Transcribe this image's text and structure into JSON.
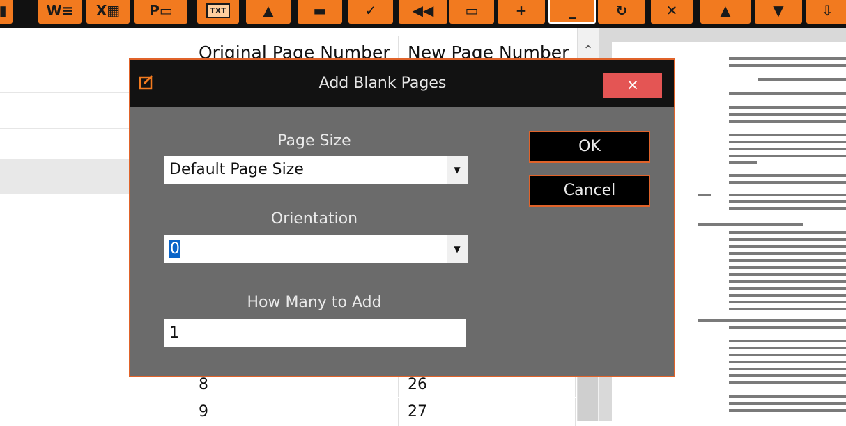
{
  "toolbar": {
    "buttons": [
      {
        "icon": "page-icon"
      },
      {
        "icon": "word-export-icon"
      },
      {
        "icon": "excel-export-icon"
      },
      {
        "icon": "powerpoint-export-icon"
      },
      {
        "icon": "txt-export-icon",
        "label": "TXT"
      },
      {
        "icon": "image-export-icon"
      },
      {
        "icon": "printer-icon"
      },
      {
        "icon": "check-icon"
      },
      {
        "icon": "rewind-icon"
      },
      {
        "icon": "screen-icon"
      },
      {
        "icon": "add-page-icon"
      },
      {
        "icon": "blank-page-icon",
        "selected": true
      },
      {
        "icon": "rotate-icon"
      },
      {
        "icon": "delete-page-icon"
      },
      {
        "icon": "move-up-icon"
      },
      {
        "icon": "move-down-icon"
      },
      {
        "icon": "move-bottom-icon"
      }
    ]
  },
  "grid": {
    "columns": [
      "Original Page Number",
      "New Page Number"
    ],
    "rows": [
      {
        "original": "8",
        "new": "26"
      },
      {
        "original": "9",
        "new": "27"
      }
    ]
  },
  "dialog": {
    "title": "Add Blank Pages",
    "close_label": "×",
    "page_size": {
      "label": "Page Size",
      "value": "Default Page Size"
    },
    "orientation": {
      "label": "Orientation",
      "value": "0"
    },
    "how_many": {
      "label": "How Many to Add",
      "value": "1"
    },
    "ok_label": "OK",
    "cancel_label": "Cancel"
  },
  "colors": {
    "accent_orange": "#f27a1f",
    "dialog_border": "#e0632a",
    "close_red": "#e45554",
    "selection_blue": "#0a64c8"
  }
}
